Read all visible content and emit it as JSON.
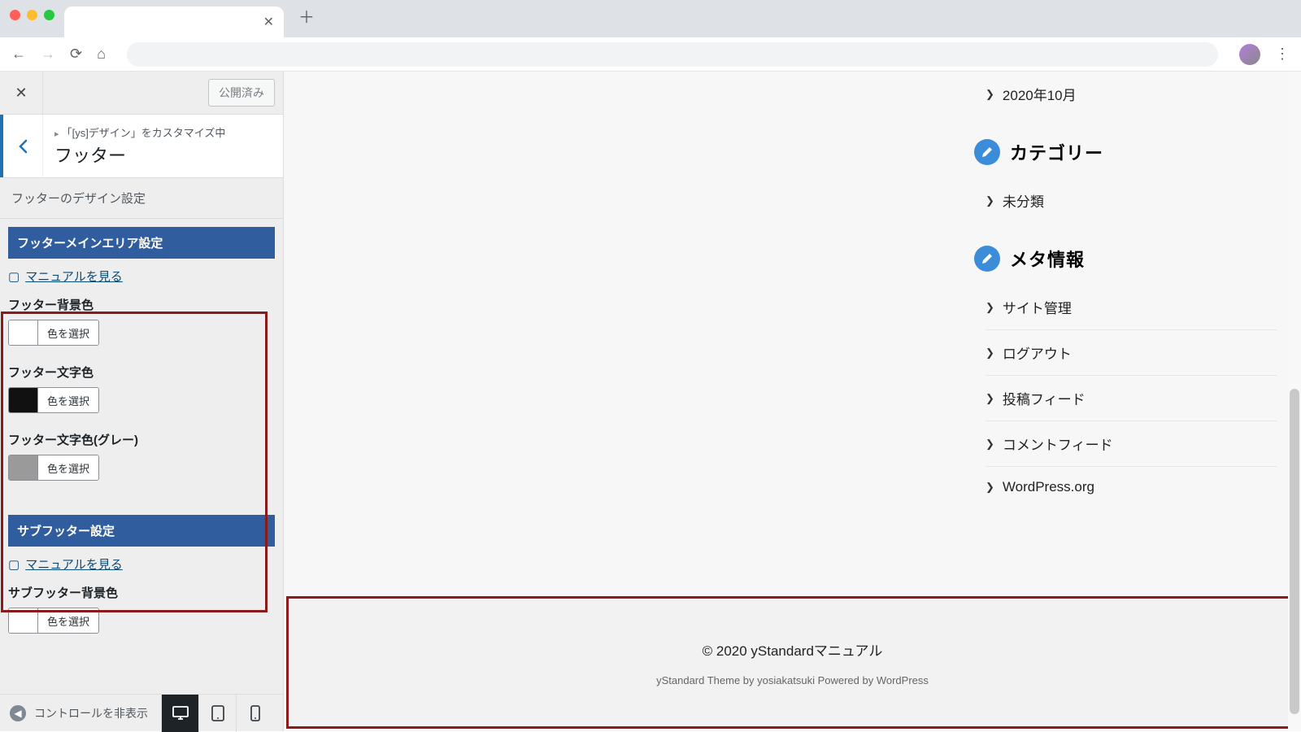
{
  "customizer": {
    "publish_label": "公開済み",
    "title_sub": "「[ys]デザイン」をカスタマイズ中",
    "title_main": "フッター",
    "description": "フッターのデザイン設定",
    "sections": [
      {
        "header": "フッターメインエリア設定",
        "manual_label": "マニュアルを見る",
        "fields": [
          {
            "label": "フッター背景色",
            "swatch": "#ffffff",
            "button": "色を選択"
          },
          {
            "label": "フッター文字色",
            "swatch": "#111111",
            "button": "色を選択"
          },
          {
            "label": "フッター文字色(グレー)",
            "swatch": "#9a9a9a",
            "button": "色を選択"
          }
        ]
      },
      {
        "header": "サブフッター設定",
        "manual_label": "マニュアルを見る",
        "fields": [
          {
            "label": "サブフッター背景色",
            "swatch": "#ffffff",
            "button": "色を選択"
          }
        ]
      }
    ],
    "collapse_label": "コントロールを非表示"
  },
  "preview": {
    "archive_item": "2020年10月",
    "widgets": [
      {
        "title": "カテゴリー",
        "items": [
          "未分類"
        ]
      },
      {
        "title": "メタ情報",
        "items": [
          "サイト管理",
          "ログアウト",
          "投稿フィード",
          "コメントフィード",
          "WordPress.org"
        ]
      }
    ],
    "footer_copy": "© 2020 yStandardマニュアル",
    "footer_credit": "yStandard Theme by yosiakatsuki Powered by WordPress"
  }
}
